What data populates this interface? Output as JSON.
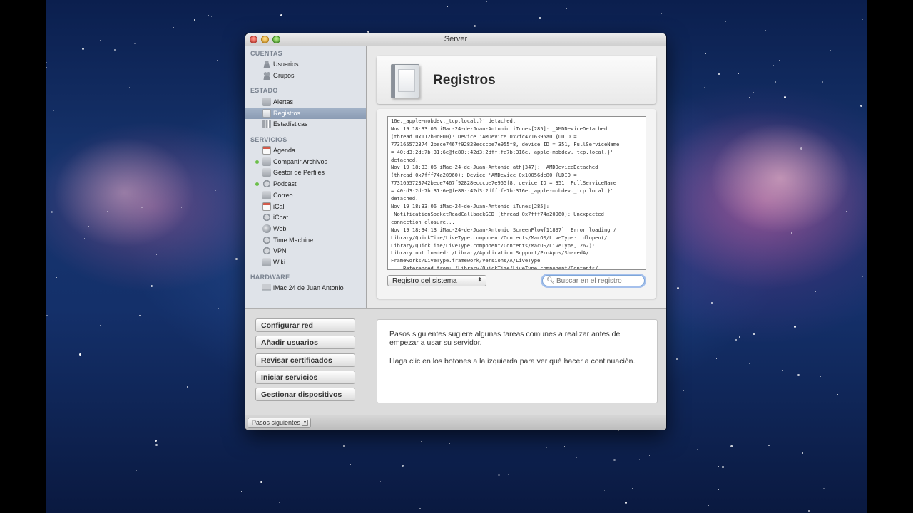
{
  "window": {
    "title": "Server"
  },
  "sidebar": {
    "sections": [
      {
        "heading": "CUENTAS",
        "items": [
          {
            "label": "Usuarios",
            "icon": "user-icon"
          },
          {
            "label": "Grupos",
            "icon": "group-icon"
          }
        ]
      },
      {
        "heading": "ESTADO",
        "items": [
          {
            "label": "Alertas",
            "icon": "alert-icon"
          },
          {
            "label": "Registros",
            "icon": "log-icon",
            "selected": true
          },
          {
            "label": "Estadísticas",
            "icon": "stats-icon"
          }
        ]
      },
      {
        "heading": "SERVICIOS",
        "items": [
          {
            "label": "Agenda",
            "icon": "calendar-icon"
          },
          {
            "label": "Compartir Archivos",
            "icon": "folder-icon",
            "status": "on"
          },
          {
            "label": "Gestor de Perfiles",
            "icon": "profile-icon"
          },
          {
            "label": "Podcast",
            "icon": "podcast-icon",
            "status": "on"
          },
          {
            "label": "Correo",
            "icon": "mail-icon"
          },
          {
            "label": "iCal",
            "icon": "ical-icon"
          },
          {
            "label": "iChat",
            "icon": "ichat-icon"
          },
          {
            "label": "Web",
            "icon": "globe-icon"
          },
          {
            "label": "Time Machine",
            "icon": "time-machine-icon"
          },
          {
            "label": "VPN",
            "icon": "vpn-icon"
          },
          {
            "label": "Wiki",
            "icon": "wiki-icon"
          }
        ]
      },
      {
        "heading": "HARDWARE",
        "items": [
          {
            "label": "iMac 24 de Juan Antonio",
            "icon": "imac-icon"
          }
        ]
      }
    ]
  },
  "main": {
    "title": "Registros",
    "log_lines": [
      "16e._apple-mobdev._tcp.local.}' detached.",
      "Nov 19 18:33:06 iMac-24-de-Juan-Antonio iTunes[285]: _AMDDeviceDetached",
      "(thread 0x112b0c000): Device 'AMDevice 0x7fc4716395a0 {UDID =",
      "773165572374 2bece7467f92828ecccbe7e955f8, device ID = 351, FullServiceName",
      "= 40:d3:2d:7b:31:6e@fe80::42d3:2dff:fe7b:316e._apple-mobdev._tcp.local.}'",
      "detached.",
      "Nov 19 18:33:06 iMac-24-de-Juan-Antonio ath[347]: _AMDDeviceDetached",
      "(thread 0x7fff74a20960): Device 'AMDevice 0x10056dc80 {UDID =",
      "7731655723742bece7467f92828ecccbe7e955f8, device ID = 351, FullServiceName",
      "= 40:d3:2d:7b:31:6e@fe80::42d3:2dff:fe7b:316e._apple-mobdev._tcp.local.}'",
      "detached.",
      "Nov 19 18:33:06 iMac-24-de-Juan-Antonio iTunes[285]:",
      "_NotificationSocketReadCallbackGCD (thread 0x7fff74a20960): Unexpected",
      "connection closure...",
      "Nov 19 18:34:13 iMac-24-de-Juan-Antonio ScreenFlow[11897]: Error loading /",
      "Library/QuickTime/LiveType.component/Contents/MacOS/LiveType:  dlopen(/",
      "Library/QuickTime/LiveType.component/Contents/MacOS/LiveType, 262):",
      "Library not loaded: /Library/Application Support/ProApps/SharedA/",
      "Frameworks/LiveType.framework/Versions/A/LiveType",
      "    Referenced from: /Library/QuickTime/LiveType.component/Contents/"
    ],
    "log_source": "Registro del sistema",
    "search_placeholder": "Buscar en el registro"
  },
  "next_steps": {
    "buttons": [
      "Configurar red",
      "Añadir usuarios",
      "Revisar certificados",
      "Iniciar servicios",
      "Gestionar dispositivos"
    ],
    "text_1": "Pasos siguientes sugiere algunas tareas comunes a realizar antes de empezar a usar su servidor.",
    "text_2": "Haga clic en los botones a la izquierda para ver qué hacer a continuación."
  },
  "statusbar": {
    "button_label": "Pasos siguientes"
  }
}
